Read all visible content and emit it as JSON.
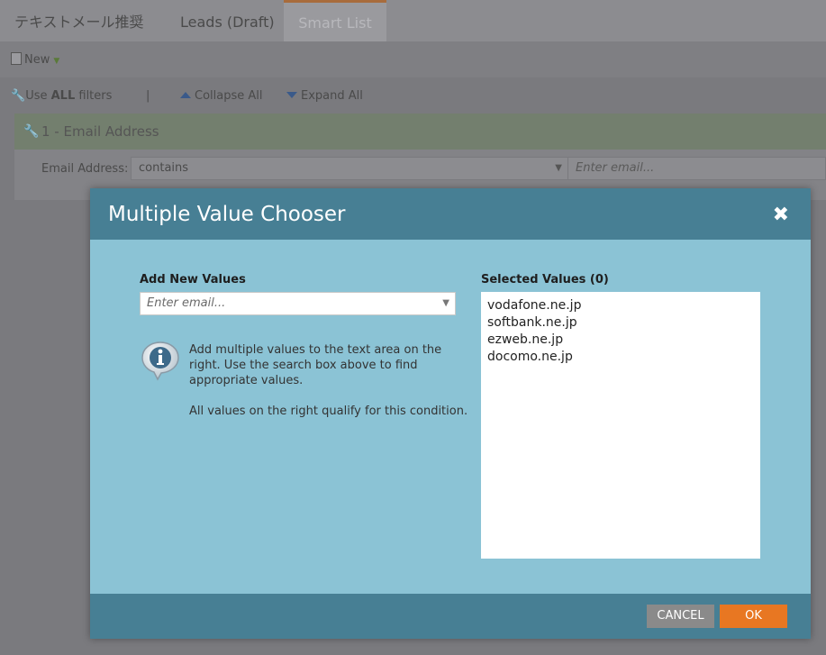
{
  "tabs": [
    {
      "label": "テキストメール推奨"
    },
    {
      "label": "Leads (Draft)"
    },
    {
      "label": "Smart List"
    }
  ],
  "toolbar": {
    "new_label": "New"
  },
  "filter_toolbar": {
    "use_prefix": "Use ",
    "use_bold": "ALL",
    "use_suffix": " filters",
    "separator": "|",
    "collapse_label": "Collapse All",
    "expand_label": "Expand All"
  },
  "filter": {
    "title": "1 - Email Address",
    "field_label": "Email Address:",
    "operator": "contains",
    "value_placeholder": "Enter email..."
  },
  "modal": {
    "title": "Multiple Value Chooser",
    "close_glyph": "✖",
    "add_label": "Add New Values",
    "add_placeholder": "Enter email...",
    "info_line1": "Add multiple values to the text area on the right. Use the search box above to find appropriate values.",
    "info_line2": "All values on the right qualify for this condition.",
    "selected_label": "Selected Values (0)",
    "values": [
      "vodafone.ne.jp",
      "softbank.ne.jp",
      "ezweb.ne.jp",
      "docomo.ne.jp"
    ],
    "cancel_label": "CANCEL",
    "ok_label": "OK"
  },
  "colors": {
    "modal_header": "#477f94",
    "modal_body": "#8bc3d5",
    "ok_button": "#e87722",
    "cancel_button": "#8a8a8a"
  }
}
